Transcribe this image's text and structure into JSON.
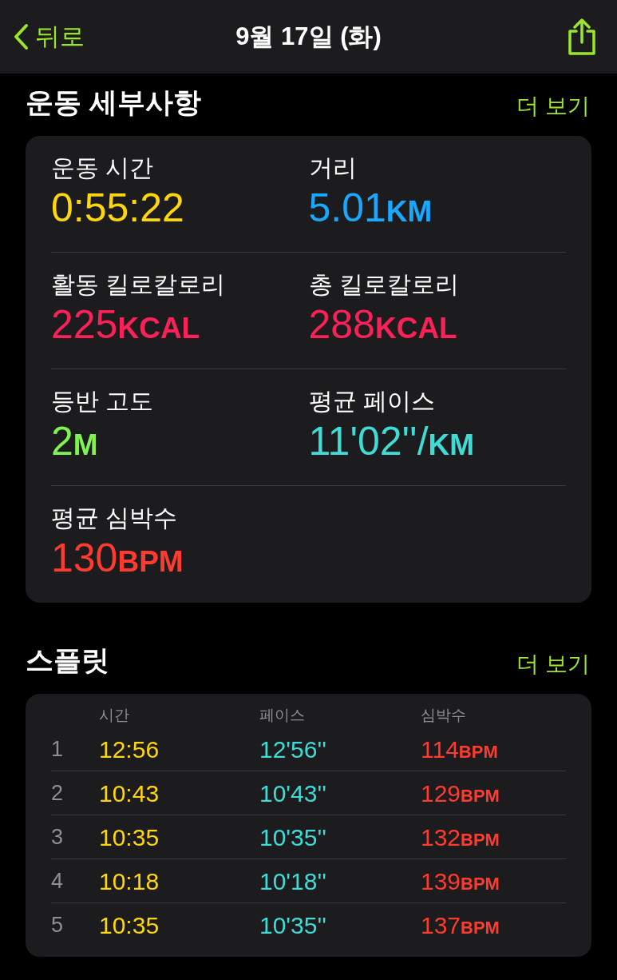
{
  "nav": {
    "back": "뒤로",
    "title": "9월 17일 (화)"
  },
  "details": {
    "title": "운동 세부사항",
    "more": "더 보기",
    "metrics": [
      {
        "label": "운동 시간",
        "value": "0:55:22",
        "color": "#ffd60a"
      },
      {
        "label": "거리",
        "value": "5.01",
        "unit": "KM",
        "color": "#17a8ff"
      },
      {
        "label": "활동 킬로칼로리",
        "value": "225",
        "unit": "KCAL",
        "color": "#fa2158"
      },
      {
        "label": "총 킬로칼로리",
        "value": "288",
        "unit": "KCAL",
        "color": "#fa2158"
      },
      {
        "label": "등반 고도",
        "value": "2",
        "unit": "M",
        "color": "#80f252"
      },
      {
        "label": "평균 페이스",
        "value": "11'02''/",
        "unit": "KM",
        "color": "#3fdcd6"
      },
      {
        "label": "평균 심박수",
        "value": "130",
        "unit": "BPM",
        "color": "#ff3b2f"
      }
    ]
  },
  "splits": {
    "title": "스플릿",
    "more": "더 보기",
    "columns": [
      "시간",
      "페이스",
      "심박수"
    ],
    "rows": [
      {
        "index": "1",
        "time": "12:56",
        "pace": "12'56''",
        "hr": "114",
        "unit": "BPM"
      },
      {
        "index": "2",
        "time": "10:43",
        "pace": "10'43''",
        "hr": "129",
        "unit": "BPM"
      },
      {
        "index": "3",
        "time": "10:35",
        "pace": "10'35''",
        "hr": "132",
        "unit": "BPM"
      },
      {
        "index": "4",
        "time": "10:18",
        "pace": "10'18''",
        "hr": "139",
        "unit": "BPM"
      },
      {
        "index": "5",
        "time": "10:35",
        "pace": "10'35''",
        "hr": "137",
        "unit": "BPM"
      }
    ]
  }
}
